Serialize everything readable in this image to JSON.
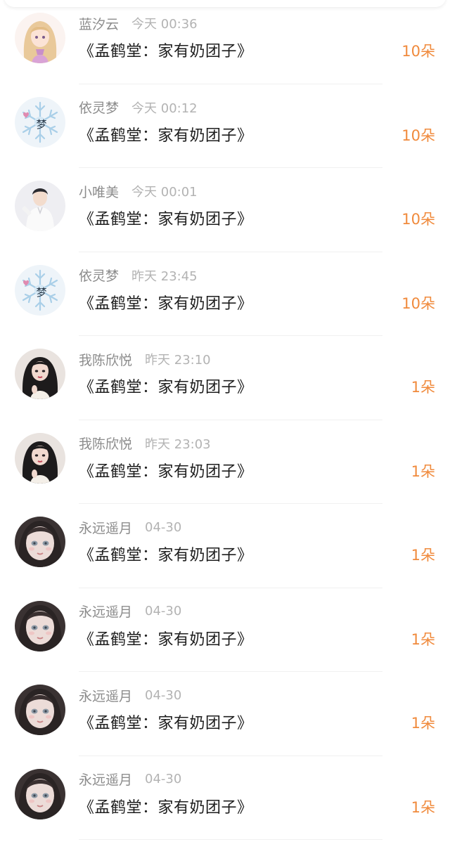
{
  "colors": {
    "username": "#8c8c8c",
    "time": "#b3b3b3",
    "title": "#1e1e1e",
    "amount": "#f08a3c",
    "divider": "#f0f0f0"
  },
  "records": [
    {
      "avatar": "anime-girl-avatar",
      "username": "蓝汐云",
      "time": "今天 00:36",
      "title": "《孟鹤堂：家有奶团子》",
      "amount": "10朵"
    },
    {
      "avatar": "snowflake-meng-avatar",
      "username": "依灵梦",
      "time": "今天 00:12",
      "title": "《孟鹤堂：家有奶团子》",
      "amount": "10朵"
    },
    {
      "avatar": "boy-white-shirt-avatar",
      "username": "小唯美",
      "time": "今天 00:01",
      "title": "《孟鹤堂：家有奶团子》",
      "amount": "10朵"
    },
    {
      "avatar": "snowflake-meng-avatar",
      "username": "依灵梦",
      "time": "昨天 23:45",
      "title": "《孟鹤堂：家有奶团子》",
      "amount": "10朵"
    },
    {
      "avatar": "dark-hair-girl-avatar",
      "username": "我陈欣悦",
      "time": "昨天 23:10",
      "title": "《孟鹤堂：家有奶团子》",
      "amount": "1朵"
    },
    {
      "avatar": "dark-hair-girl-avatar",
      "username": "我陈欣悦",
      "time": "昨天 23:03",
      "title": "《孟鹤堂：家有奶团子》",
      "amount": "1朵"
    },
    {
      "avatar": "pale-girl-avatar",
      "username": "永远遥月",
      "time": "04-30",
      "title": "《孟鹤堂：家有奶团子》",
      "amount": "1朵"
    },
    {
      "avatar": "pale-girl-avatar",
      "username": "永远遥月",
      "time": "04-30",
      "title": "《孟鹤堂：家有奶团子》",
      "amount": "1朵"
    },
    {
      "avatar": "pale-girl-avatar",
      "username": "永远遥月",
      "time": "04-30",
      "title": "《孟鹤堂：家有奶团子》",
      "amount": "1朵"
    },
    {
      "avatar": "pale-girl-avatar",
      "username": "永远遥月",
      "time": "04-30",
      "title": "《孟鹤堂：家有奶团子》",
      "amount": "1朵"
    }
  ]
}
